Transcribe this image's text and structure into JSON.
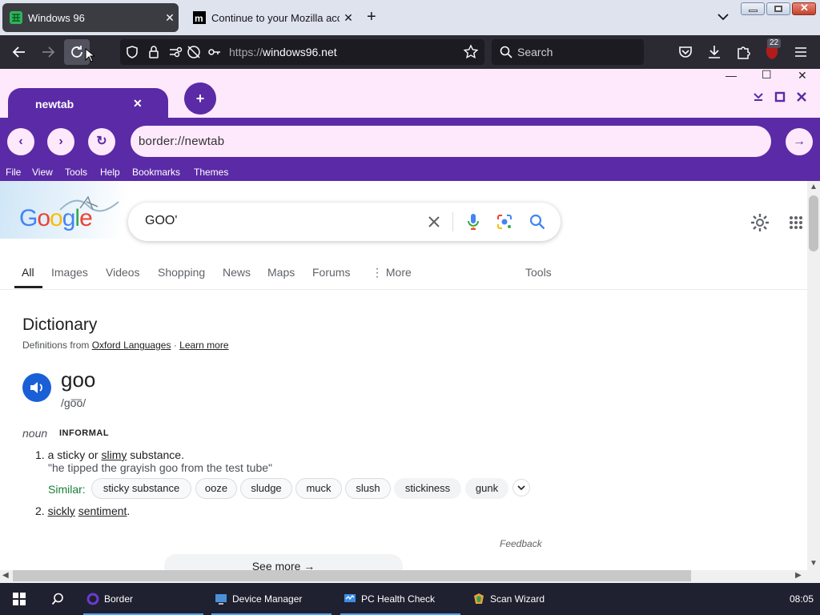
{
  "firefox": {
    "tabs": [
      {
        "title": "Windows 96",
        "active": true
      },
      {
        "title": "Continue to your Mozilla account",
        "active": false
      }
    ],
    "url_protocol": "https://",
    "url_host": "windows96.net",
    "search_placeholder": "Search",
    "extension_badge": "22"
  },
  "border": {
    "tab_label": "newtab",
    "address": "border://newtab",
    "menu": [
      "File",
      "View",
      "Tools",
      "Help",
      "Bookmarks",
      "Themes"
    ],
    "accent": "#5b2aa6",
    "background": "#fde9fb"
  },
  "google": {
    "logo": "Google",
    "query": "GOO'",
    "tabs": [
      "All",
      "Images",
      "Videos",
      "Shopping",
      "News",
      "Maps",
      "Forums",
      "More",
      "Tools"
    ]
  },
  "dictionary": {
    "title": "Dictionary",
    "source_prefix": "Definitions from",
    "source_link": "Oxford Languages",
    "source_sep": "·",
    "learn_more": "Learn more",
    "word": "goo",
    "phonetic": "/go͞o/",
    "part_of_speech": "noun",
    "register": "INFORMAL",
    "def1_num": "1.",
    "def1_a": "a sticky or",
    "def1_link": "slimy",
    "def1_b": "substance.",
    "example1": "\"he tipped the grayish goo from the test tube\"",
    "similar_label": "Similar:",
    "similar": [
      "sticky substance",
      "ooze",
      "sludge",
      "muck",
      "slush",
      "stickiness",
      "gunk"
    ],
    "def2_num": "2.",
    "def2_link1": "sickly",
    "def2_link2": "sentiment",
    "def2_end": ".",
    "feedback": "Feedback",
    "see_more": "See more"
  },
  "taskbar": {
    "items": [
      "Border",
      "Device Manager",
      "PC Health Check",
      "Scan Wizard"
    ],
    "clock": "08:05"
  }
}
